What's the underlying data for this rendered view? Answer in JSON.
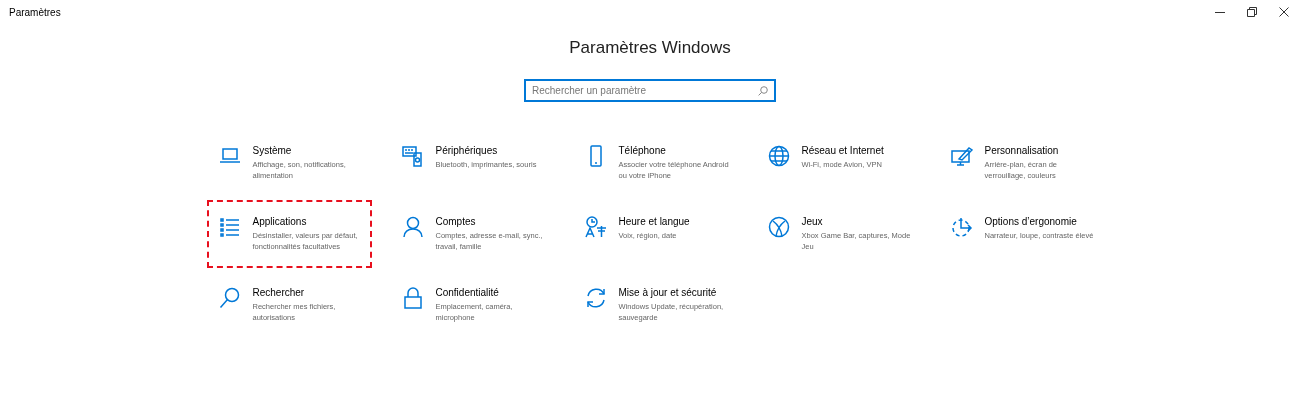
{
  "window": {
    "title": "Paramètres"
  },
  "heading": "Paramètres Windows",
  "search": {
    "placeholder": "Rechercher un paramètre"
  },
  "tiles": [
    {
      "title": "Système",
      "description": "Affichage, son, notifications, alimentation",
      "highlighted": false
    },
    {
      "title": "Périphériques",
      "description": "Bluetooth, imprimantes, souris",
      "highlighted": false
    },
    {
      "title": "Téléphone",
      "description": "Associer votre téléphone Android ou votre iPhone",
      "highlighted": false
    },
    {
      "title": "Réseau et Internet",
      "description": "Wi-Fi, mode Avion, VPN",
      "highlighted": false
    },
    {
      "title": "Personnalisation",
      "description": "Arrière-plan, écran de verrouillage, couleurs",
      "highlighted": false
    },
    {
      "title": "Applications",
      "description": "Désinstaller, valeurs par défaut, fonctionnalités facultatives",
      "highlighted": true
    },
    {
      "title": "Comptes",
      "description": "Comptes, adresse e-mail, sync., travail, famille",
      "highlighted": false
    },
    {
      "title": "Heure et langue",
      "description": "Voix, région, date",
      "highlighted": false
    },
    {
      "title": "Jeux",
      "description": "Xbox Game Bar, captures, Mode Jeu",
      "highlighted": false
    },
    {
      "title": "Options d’ergonomie",
      "description": "Narrateur, loupe, contraste élevé",
      "highlighted": false
    },
    {
      "title": "Rechercher",
      "description": "Rechercher mes fichiers, autorisations",
      "highlighted": false
    },
    {
      "title": "Confidentialité",
      "description": "Emplacement, caméra, microphone",
      "highlighted": false
    },
    {
      "title": "Mise à jour et sécurité",
      "description": "Windows Update, récupération, sauvegarde",
      "highlighted": false
    }
  ]
}
